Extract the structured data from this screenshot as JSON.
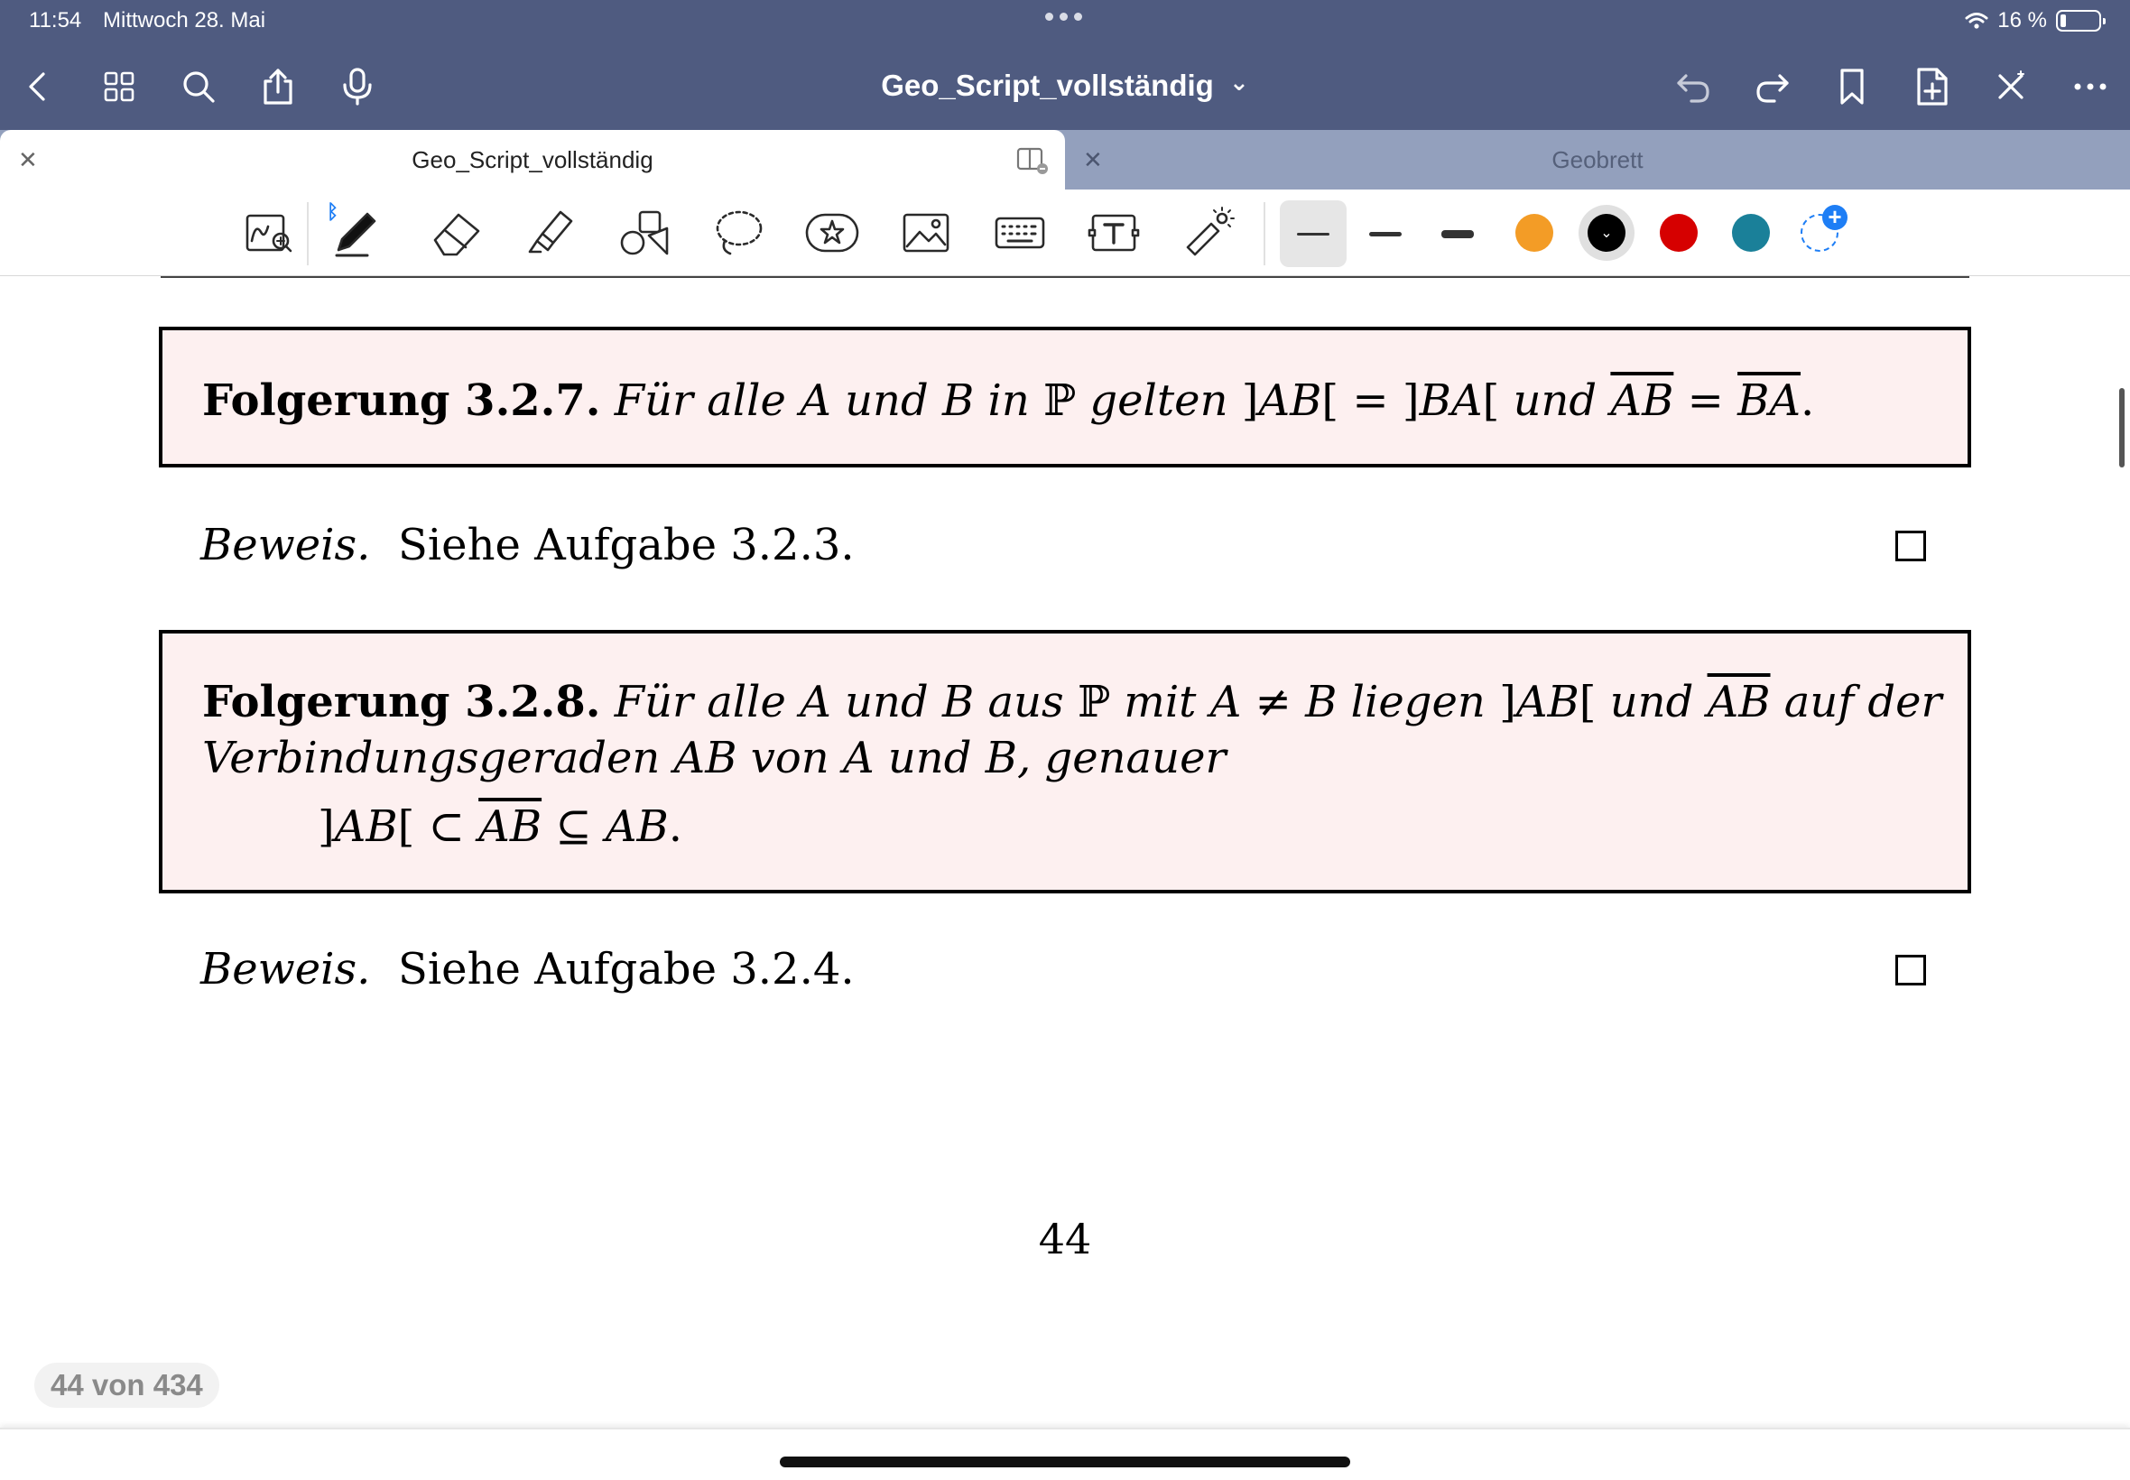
{
  "status_bar": {
    "time": "11:54",
    "date": "Mittwoch 28. Mai",
    "battery": "16 %",
    "battery_level": 0.16
  },
  "nav": {
    "title": "Geo_Script_vollständig",
    "title_chevron": "⌄",
    "left_icons": [
      "back-icon",
      "grid-icon",
      "search-icon",
      "share-icon",
      "microphone-icon"
    ],
    "right_icons": [
      "undo-icon",
      "redo-icon",
      "bookmark-icon",
      "add-page-icon",
      "close-cross-icon",
      "more-icon"
    ]
  },
  "tabs": [
    {
      "label": "Geo_Script_vollständig",
      "active": true
    },
    {
      "label": "Geobrett",
      "active": false
    }
  ],
  "toolbar": {
    "tools": [
      "zoom-pen-icon",
      "pen-icon",
      "eraser-icon",
      "highlighter-icon",
      "shapes-icon",
      "lasso-icon",
      "sticker-icon",
      "image-icon",
      "keyboard-icon",
      "text-box-icon",
      "laser-pointer-icon"
    ],
    "stroke_widths": [
      "thin",
      "medium",
      "thick"
    ],
    "colors": [
      "#f39c26",
      "#000000",
      "#d60000",
      "#1a8099"
    ],
    "selected_color": "#000000",
    "add_color": "+"
  },
  "document": {
    "f327": {
      "label": "Folgerung 3.2.7.",
      "t1": "Für alle",
      "A": "A",
      "und": "und",
      "B": "B",
      "in": "in",
      "P": "ℙ",
      "gelten": "gelten",
      "open1": "]",
      "AB": "AB",
      "close1": "[",
      "eq": "=",
      "open2": "]",
      "BA": "BA",
      "close2": "[",
      "und2": "und",
      "ABbar": "AB",
      "eq2": "=",
      "BAbar": "BA",
      "dot": "."
    },
    "proof1": {
      "label": "Beweis.",
      "text": "Siehe Aufgabe 3.2.3."
    },
    "f328": {
      "label": "Folgerung 3.2.8.",
      "t1": "Für alle",
      "A": "A",
      "und": "und",
      "B": "B",
      "aus": "aus",
      "P": "ℙ",
      "mit": "mit",
      "neq": "A ≠ B",
      "liegen": "liegen",
      "open1": "]",
      "AB": "AB",
      "close1": "[",
      "und2": "und",
      "ABbar": "AB",
      "aufder": "auf der",
      "line2a": "Verbindungsgeraden",
      "line2AB": "AB",
      "line2b": "von",
      "line2A": "A",
      "line2und": "und",
      "line2B": "B,",
      "line2c": "genauer",
      "f_open": "]",
      "f_AB": "AB",
      "f_close": "[",
      "f_sub": "⊂",
      "f_ABbar": "AB",
      "f_subeq": "⊆",
      "f_AB2": "AB",
      "f_dot": "."
    },
    "proof2": {
      "label": "Beweis.",
      "text": "Siehe Aufgabe 3.2.4."
    },
    "page_number": "44"
  },
  "page_indicator": "44 von 434"
}
